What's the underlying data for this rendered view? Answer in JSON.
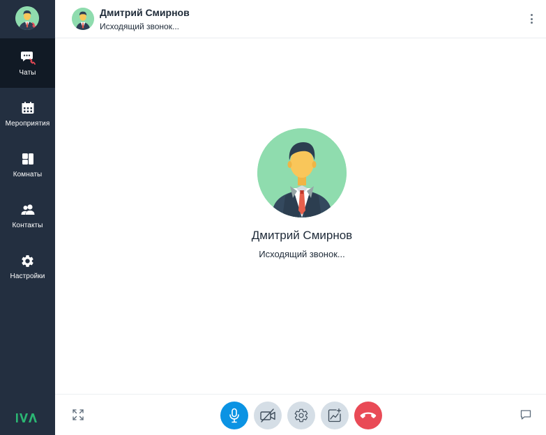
{
  "sidebar": {
    "items": [
      {
        "label": "Чаты",
        "icon": "chat-call-icon",
        "active": true
      },
      {
        "label": "Мероприятия",
        "icon": "calendar-icon",
        "active": false
      },
      {
        "label": "Комнаты",
        "icon": "rooms-icon",
        "active": false
      },
      {
        "label": "Контакты",
        "icon": "contacts-icon",
        "active": false
      },
      {
        "label": "Настройки",
        "icon": "gear-icon",
        "active": false
      }
    ],
    "logo_text": "IVA"
  },
  "header": {
    "name": "Дмитрий Смирнов",
    "status": "Исходящий звонок..."
  },
  "call": {
    "name": "Дмитрий Смирнов",
    "status": "Исходящий звонок..."
  },
  "controls": {
    "icons": [
      "microphone-icon",
      "camera-off-icon",
      "settings-icon",
      "screen-share-icon",
      "hang-up-icon"
    ]
  },
  "colors": {
    "sidebar_bg": "#232f40",
    "sidebar_active_bg": "#111a25",
    "mic_button": "#0b93e3",
    "hangup_button": "#e94a56",
    "grey_button": "#d5dee6",
    "avatar_bg": "#8fdcae",
    "logo_green": "#2bb673"
  }
}
